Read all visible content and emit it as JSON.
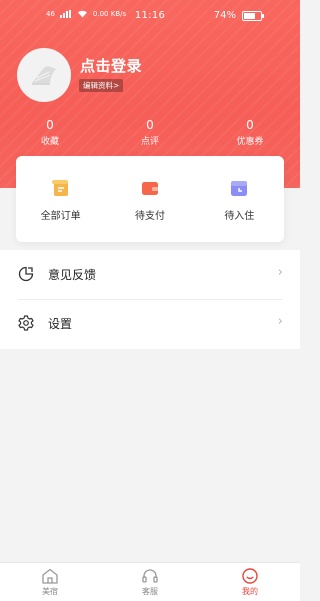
{
  "status_bar": {
    "left_text": "46",
    "speed": "0.00 KB/s",
    "time": "11:16",
    "battery": "74%"
  },
  "profile": {
    "title": "点击登录",
    "edit_label": "编辑资料>"
  },
  "stats": [
    {
      "value": "0",
      "label": "收藏"
    },
    {
      "value": "0",
      "label": "点评"
    },
    {
      "value": "0",
      "label": "优惠券"
    }
  ],
  "orders": [
    {
      "label": "全部订单",
      "icon": "all-orders-icon",
      "color": "#f6b54a"
    },
    {
      "label": "待支付",
      "icon": "wallet-icon",
      "color": "#f6664a"
    },
    {
      "label": "待入住",
      "icon": "calendar-icon",
      "color": "#8c8cf5"
    }
  ],
  "menu": [
    {
      "label": "意见反馈",
      "icon": "feedback-icon"
    },
    {
      "label": "设置",
      "icon": "settings-icon"
    }
  ],
  "tabs": [
    {
      "label": "美宿",
      "icon": "home-icon",
      "active": false
    },
    {
      "label": "客服",
      "icon": "headset-icon",
      "active": false
    },
    {
      "label": "我的",
      "icon": "profile-icon",
      "active": true
    }
  ],
  "colors": {
    "brand": "#f65e57",
    "active_tab": "#e8453c"
  }
}
